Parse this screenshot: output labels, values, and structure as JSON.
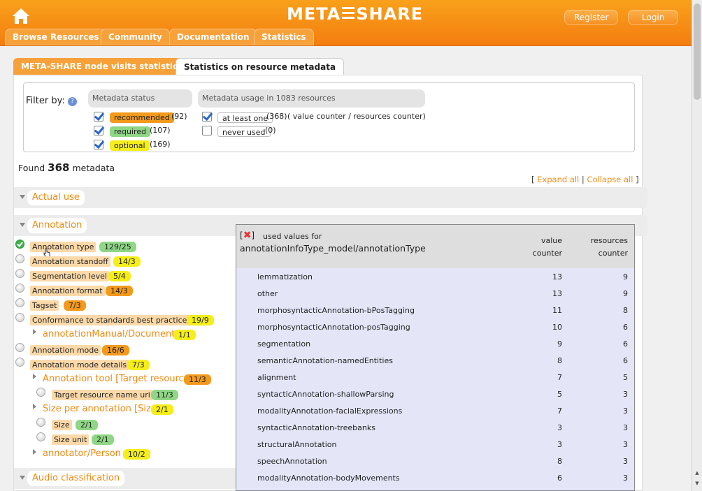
{
  "header": {
    "logo_left": "META",
    "logo_right": "SHARE",
    "register": "Register",
    "login": "Login"
  },
  "nav": [
    "Browse Resources",
    "Community",
    "Documentation",
    "Statistics"
  ],
  "tabs": [
    "META-SHARE node visits statistics",
    "Statistics on resource metadata"
  ],
  "filter": {
    "label": "Filter by:",
    "status_header": "Metadata status",
    "usage_header": "Metadata usage in 1083 resources",
    "status": [
      {
        "label": "recommended",
        "count": "(92)",
        "checked": true
      },
      {
        "label": "required",
        "count": "(107)",
        "checked": true
      },
      {
        "label": "optional",
        "count": "(169)",
        "checked": true
      }
    ],
    "usage": [
      {
        "label": "at least one",
        "count": "(368)",
        "note": "( value counter / resources counter)",
        "checked": true
      },
      {
        "label": "never used",
        "count": "(0)",
        "checked": false
      }
    ]
  },
  "found": {
    "prefix": "Found",
    "count": "368",
    "suffix": "metadata"
  },
  "expand": {
    "open": "[",
    "expand_all": "Expand all",
    "sep": "|",
    "collapse_all": "Collapse all",
    "close": "]"
  },
  "sections": [
    "Actual use",
    "Annotation",
    "Audio classification"
  ],
  "items": [
    {
      "label": "Annotation type",
      "badge": "129/25"
    },
    {
      "label": "Annotation standoff",
      "badge": "14/3"
    },
    {
      "label": "Segmentation level",
      "badge": "5/4"
    },
    {
      "label": "Annotation format",
      "badge": "14/3"
    },
    {
      "label": "Tagset",
      "badge": "7/3"
    },
    {
      "label": "Conformance to standards best practices",
      "badge": "19/9"
    },
    {
      "label": "annotationManual/Document",
      "badge": "1/1"
    },
    {
      "label": "Annotation mode",
      "badge": "16/6"
    },
    {
      "label": "Annotation mode details",
      "badge": "7/3"
    },
    {
      "label": "Annotation tool [Target resource]",
      "badge": "11/3"
    },
    {
      "label": "Target resource name uri",
      "badge": "11/3"
    },
    {
      "label": "Size per annotation [Size]",
      "badge": "2/1"
    },
    {
      "label": "Size",
      "badge": "2/1"
    },
    {
      "label": "Size unit",
      "badge": "2/1"
    },
    {
      "label": "annotator/Person",
      "badge": "10/2"
    }
  ],
  "popup": {
    "close_open": "[",
    "close_glyph": "✖",
    "close_end": "]",
    "title1": "used values for",
    "title2": "annotationInfoType_model/annotationType",
    "col1": [
      "value",
      "counter"
    ],
    "col2": [
      "resources",
      "counter"
    ],
    "rows": [
      [
        "lemmatization",
        "13",
        "9"
      ],
      [
        "other",
        "13",
        "9"
      ],
      [
        "morphosyntacticAnnotation-bPosTagging",
        "11",
        "8"
      ],
      [
        "morphosyntacticAnnotation-posTagging",
        "10",
        "6"
      ],
      [
        "segmentation",
        "9",
        "6"
      ],
      [
        "semanticAnnotation-namedEntities",
        "8",
        "6"
      ],
      [
        "alignment",
        "7",
        "5"
      ],
      [
        "syntacticAnnotation-shallowParsing",
        "5",
        "3"
      ],
      [
        "modalityAnnotation-facialExpressions",
        "7",
        "3"
      ],
      [
        "syntacticAnnotation-treebanks",
        "3",
        "3"
      ],
      [
        "structuralAnnotation",
        "3",
        "3"
      ],
      [
        "speechAnnotation",
        "8",
        "3"
      ],
      [
        "modalityAnnotation-bodyMovements",
        "6",
        "3"
      ]
    ]
  }
}
